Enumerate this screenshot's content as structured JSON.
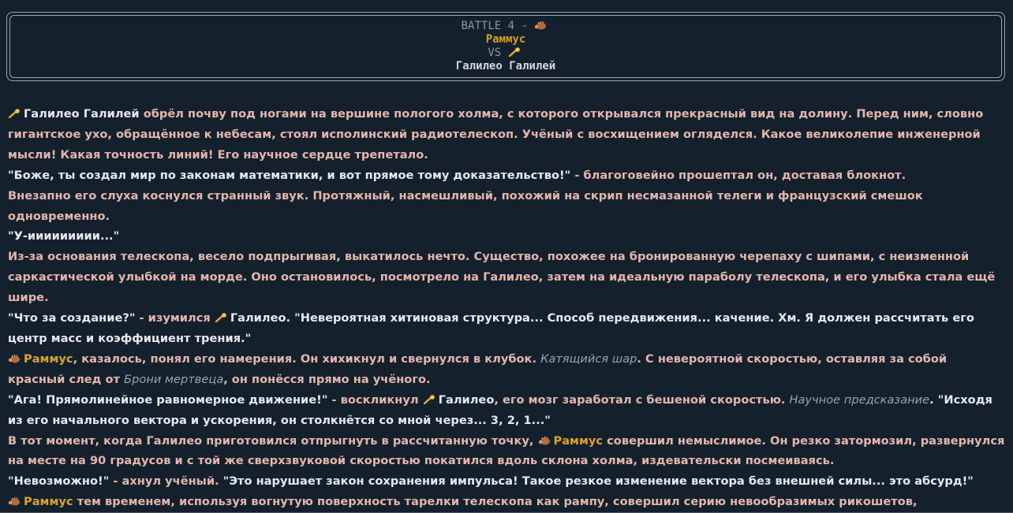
{
  "header": {
    "battle": "BATTLE 4 -",
    "player1": "Раммус",
    "vs": "VS",
    "player2": "Галилео Галилей"
  },
  "story": {
    "p1_name": "Галилео Галилей",
    "p1_text": " обрёл почву под ногами на вершине пологого холма, с которого открывался прекрасный вид на долину. Перед ним, словно гигантское ухо, обращённое к небесам, стоял исполинский радиотелескоп. Учёный с восхищением огляделся. Какое великолепие инженерной мысли! Какая точность линий! Его научное сердце трепетало.",
    "p2_speech": "\"Боже, ты создал мир по законам математики, и вот прямое тому доказательство!\"",
    "p2_narr": " - благоговейно прошептал он, доставая блокнот.",
    "p3": "Внезапно его слуха коснулся странный звук. Протяжный, насмешливый, похожий на скрип несмазанной телеги и французский смешок одновременно.",
    "p4": "\"У-иииииииии...\"",
    "p5": "Из-за основания телескопа, весело подпрыгивая, выкатилось нечто. Существо, похожее на бронированную черепаху с шипами, с неизменной саркастической улыбкой на морде. Оно остановилось, посмотрело на Галилео, затем на идеальную параболу телескопа, и его улыбка стала ещё шире.",
    "p6_speech1": "\"Что за создание?\"",
    "p6_narr": " - изумился ",
    "p6_name": "Галилео",
    "p6_speech2": ". \"Невероятная хитиновая структура... Способ передвижения... качение. Хм. Я должен рассчитать его центр масс и коэффициент трения.\"",
    "p7_name": "Раммус",
    "p7_text1": ", казалось, понял его намерения. Он хихикнул и свернулся в клубок. ",
    "p7_skill1": "Катящийся шар",
    "p7_text2": ". С невероятной скоростью, оставляя за собой красный след от ",
    "p7_skill2": "Брони мертвеца",
    "p7_text3": ", он понёсся прямо на учёного.",
    "p8_speech1": "\"Ага! Прямолинейное равномерное движение!\"",
    "p8_narr1": " - воскликнул ",
    "p8_name": "Галилео",
    "p8_narr2": ", его мозг заработал с бешеной скоростью. ",
    "p8_skill": "Научное предсказание",
    "p8_speech2": ". \"Исходя из его начального вектора и ускорения, он столкнётся со мной через... 3, 2, 1...\"",
    "p9_text1": "В тот момент, когда Галилео приготовился отпрыгнуть в рассчитанную точку, ",
    "p9_name": "Раммус",
    "p9_text2": " совершил немыслимое. Он резко затормозил, развернулся на месте на 90 градусов и с той же сверхзвуковой скоростью покатился вдоль склона холма, издевательски посмеиваясь.",
    "p10_speech1": "\"Невозможно!\"",
    "p10_narr": " - ахнул учёный. ",
    "p10_speech2": "\"Это нарушает закон сохранения импульса! Такое резкое изменение вектора без внешней силы... это абсурд!\"",
    "p11_name": "Раммус",
    "p11_text": " тем временем, используя вогнутую поверхность тарелки телескопа как рампу, совершил серию невообразимых рикошетов,"
  },
  "icons": {
    "rammus": "armadillo-icon",
    "galileo": "comet-icon"
  }
}
